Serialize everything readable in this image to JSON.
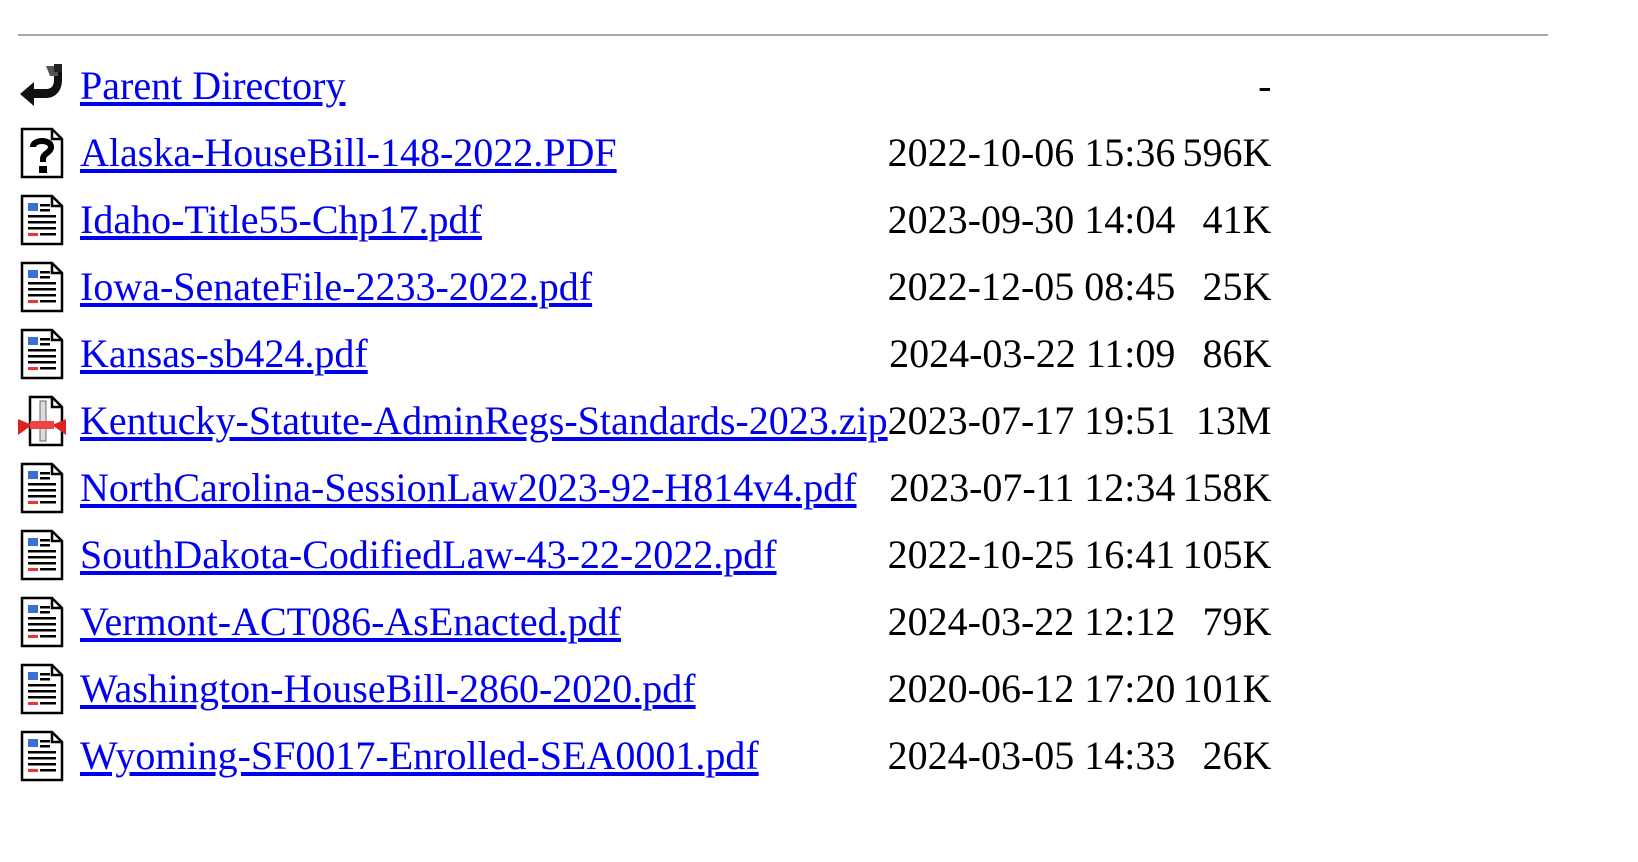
{
  "listing": {
    "parent": {
      "label": "Parent Directory",
      "size": "-",
      "icon": "back-arrow-icon"
    },
    "rows": [
      {
        "name": "Alaska-HouseBill-148-2022.PDF",
        "date": "2022-10-06 15:36",
        "size": "596K",
        "icon": "unknown-file-icon"
      },
      {
        "name": "Idaho-Title55-Chp17.pdf",
        "date": "2023-09-30 14:04",
        "size": "41K",
        "icon": "document-icon"
      },
      {
        "name": "Iowa-SenateFile-2233-2022.pdf",
        "date": "2022-12-05 08:45",
        "size": "25K",
        "icon": "document-icon"
      },
      {
        "name": "Kansas-sb424.pdf",
        "date": "2024-03-22 11:09",
        "size": "86K",
        "icon": "document-icon"
      },
      {
        "name": "Kentucky-Statute-AdminRegs-Standards-2023.zip",
        "date": "2023-07-17 19:51",
        "size": "13M",
        "icon": "compressed-file-icon"
      },
      {
        "name": "NorthCarolina-SessionLaw2023-92-H814v4.pdf",
        "date": "2023-07-11 12:34",
        "size": "158K",
        "icon": "document-icon"
      },
      {
        "name": "SouthDakota-CodifiedLaw-43-22-2022.pdf",
        "date": "2022-10-25 16:41",
        "size": "105K",
        "icon": "document-icon"
      },
      {
        "name": "Vermont-ACT086-AsEnacted.pdf",
        "date": "2024-03-22 12:12",
        "size": "79K",
        "icon": "document-icon"
      },
      {
        "name": "Washington-HouseBill-2860-2020.pdf",
        "date": "2020-06-12 17:20",
        "size": "101K",
        "icon": "document-icon"
      },
      {
        "name": "Wyoming-SF0017-Enrolled-SEA0001.pdf",
        "date": "2024-03-05 14:33",
        "size": "26K",
        "icon": "document-icon"
      }
    ]
  },
  "colors": {
    "link": "#0000ee",
    "text": "#000000",
    "rule": "#a8a8a8"
  }
}
